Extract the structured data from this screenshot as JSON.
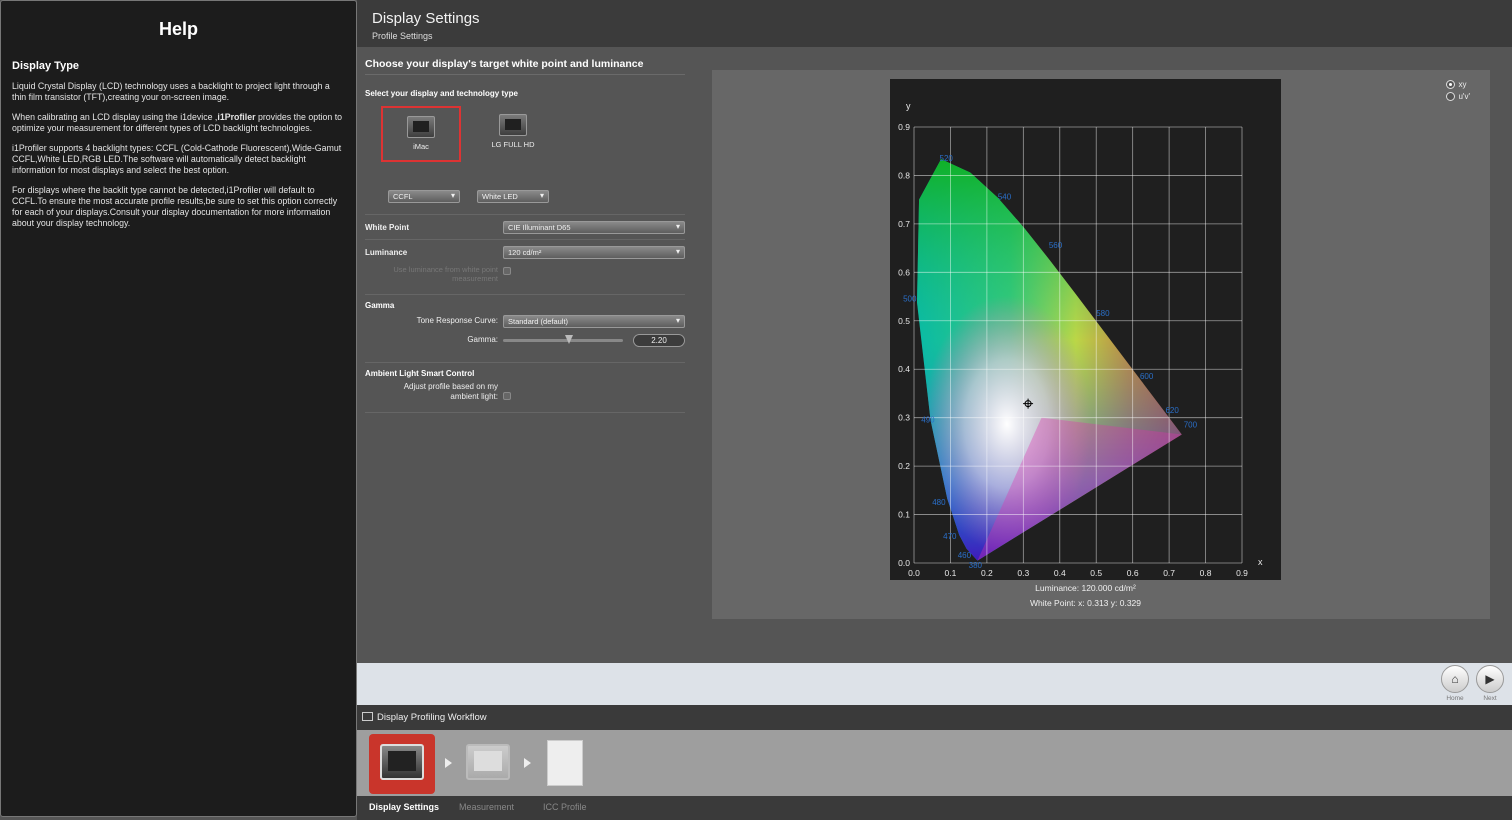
{
  "help": {
    "title": "Help",
    "heading": "Display Type",
    "p1": "Liquid Crystal Display (LCD) technology uses a backlight to project light through a thin film transistor (TFT),creating your on-screen image.",
    "p2_a": "When calibrating an LCD display using the i1device ,",
    "p2_b": "i1Profiler",
    "p2_c": " provides the option to optimize your measurement for different types of LCD backlight technologies.",
    "p3": "i1Profiler supports 4 backlight types: CCFL (Cold-Cathode Fluorescent),Wide-Gamut CCFL,White LED,RGB LED.The software will automatically detect backlight information for most displays and select the best option.",
    "p4": "For displays where the backlit type cannot be detected,i1Profiler will default to CCFL.To ensure the most accurate profile results,be sure to set this option correctly for each of your displays.Consult your display documentation for more information about your display technology."
  },
  "header": {
    "title": "Display Settings",
    "subtitle": "Profile Settings"
  },
  "settings": {
    "section_title": "Choose your display's target white point and luminance",
    "select_label": "Select your display and technology type",
    "displays": [
      {
        "label": "iMac"
      },
      {
        "label": "LG FULL HD"
      }
    ],
    "tech": [
      "CCFL",
      "White LED"
    ],
    "white_point_label": "White Point",
    "white_point_value": "CIE Illuminant D65",
    "luminance_label": "Luminance",
    "luminance_value": "120 cd/m²",
    "luminance_note_1": "Use luminance from white point",
    "luminance_note_2": "measurement",
    "gamma_label": "Gamma",
    "trc_label": "Tone Response Curve:",
    "trc_value": "Standard (default)",
    "gamma_value_label": "Gamma:",
    "gamma_value": "2.20",
    "gamma_fraction": 0.55,
    "ambient_title": "Ambient Light Smart Control",
    "ambient_label_1": "Adjust profile based on my",
    "ambient_label_2": "ambient light:"
  },
  "chart_data": {
    "type": "scatter",
    "xlabel": "x",
    "ylabel": "y",
    "xlim": [
      0,
      0.9
    ],
    "ylim": [
      0,
      0.9
    ],
    "ticks": [
      "0.0",
      "0.1",
      "0.2",
      "0.3",
      "0.4",
      "0.5",
      "0.6",
      "0.7",
      "0.8",
      "0.9"
    ],
    "grid": true,
    "gamut": [
      [
        0.64,
        0.33
      ],
      [
        0.3,
        0.6
      ],
      [
        0.15,
        0.06
      ]
    ],
    "wavelengths": [
      {
        "label": "520",
        "x": 0.07,
        "y": 0.83
      },
      {
        "label": "540",
        "x": 0.23,
        "y": 0.75
      },
      {
        "label": "560",
        "x": 0.37,
        "y": 0.65
      },
      {
        "label": "580",
        "x": 0.5,
        "y": 0.51
      },
      {
        "label": "600",
        "x": 0.62,
        "y": 0.38
      },
      {
        "label": "620",
        "x": 0.69,
        "y": 0.31
      },
      {
        "label": "700",
        "x": 0.74,
        "y": 0.28
      },
      {
        "label": "500",
        "x": -0.03,
        "y": 0.54
      },
      {
        "label": "490",
        "x": 0.02,
        "y": 0.29
      },
      {
        "label": "480",
        "x": 0.05,
        "y": 0.12
      },
      {
        "label": "470",
        "x": 0.08,
        "y": 0.05
      },
      {
        "label": "460",
        "x": 0.12,
        "y": 0.01
      },
      {
        "label": "380",
        "x": 0.15,
        "y": -0.01
      }
    ],
    "white_point": {
      "x": 0.313,
      "y": 0.329
    }
  },
  "chart_info": {
    "luminance": "Luminance: 120.000 cd/m²",
    "white_point": "White Point: x: 0.313  y: 0.329"
  },
  "radios": [
    {
      "label": "xy",
      "checked": true
    },
    {
      "label": "u'v'",
      "checked": false
    }
  ],
  "nav": {
    "home": "Home",
    "next": "Next"
  },
  "workflow": {
    "title": "Display Profiling Workflow",
    "steps": [
      "Display Settings",
      "Measurement",
      "ICC Profile"
    ]
  },
  "colors": {
    "accent": "#c9352b",
    "wave_label": "#2a6fc9"
  }
}
